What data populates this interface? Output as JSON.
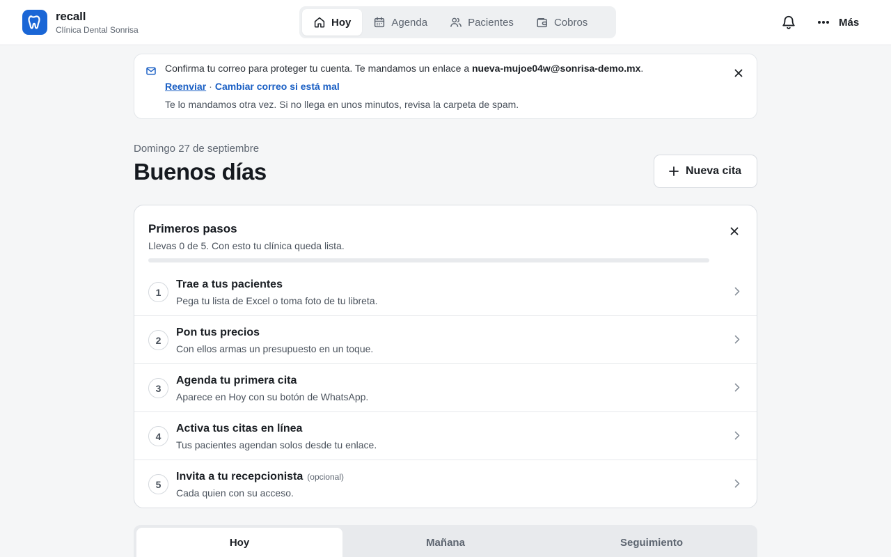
{
  "brand": {
    "name": "recall",
    "clinic": "Clínica Dental Sonrisa",
    "accent": "#1a66d6"
  },
  "nav": {
    "items": [
      {
        "label": "Hoy",
        "icon": "home-icon",
        "active": true
      },
      {
        "label": "Agenda",
        "icon": "calendar-icon",
        "active": false
      },
      {
        "label": "Pacientes",
        "icon": "users-icon",
        "active": false
      },
      {
        "label": "Cobros",
        "icon": "wallet-icon",
        "active": false
      }
    ],
    "more_label": "Más"
  },
  "email_banner": {
    "text_before": "Confirma tu correo para proteger tu cuenta. Te mandamos un enlace a",
    "email": "nueva-mujoe04w@sonrisa-demo.mx",
    "text_after": ".",
    "resend_label": "Reenviar",
    "separator": "·",
    "change_label": "Cambiar correo si está mal",
    "note": "Te lo mandamos otra vez. Si no llega en unos minutos, revisa la carpeta de spam."
  },
  "header": {
    "date": "Domingo 27 de septiembre",
    "greeting": "Buenos días",
    "new_appointment_label": "Nueva cita"
  },
  "onboarding": {
    "title": "Primeros pasos",
    "subtitle": "Llevas 0 de 5. Con esto tu clínica queda lista.",
    "progress": 0,
    "steps": [
      {
        "number": "1",
        "title": "Trae a tus pacientes",
        "optional": "",
        "subtitle": "Pega tu lista de Excel o toma foto de tu libreta."
      },
      {
        "number": "2",
        "title": "Pon tus precios",
        "optional": "",
        "subtitle": "Con ellos armas un presupuesto en un toque."
      },
      {
        "number": "3",
        "title": "Agenda tu primera cita",
        "optional": "",
        "subtitle": "Aparece en Hoy con su botón de WhatsApp."
      },
      {
        "number": "4",
        "title": "Activa tus citas en línea",
        "optional": "",
        "subtitle": "Tus pacientes agendan solos desde tu enlace."
      },
      {
        "number": "5",
        "title": "Invita a tu recepcionista",
        "optional": "(opcional)",
        "subtitle": "Cada quien con su acceso."
      }
    ]
  },
  "tabs": {
    "items": [
      {
        "label": "Hoy",
        "active": true
      },
      {
        "label": "Mañana",
        "active": false
      },
      {
        "label": "Seguimiento",
        "active": false
      }
    ]
  }
}
